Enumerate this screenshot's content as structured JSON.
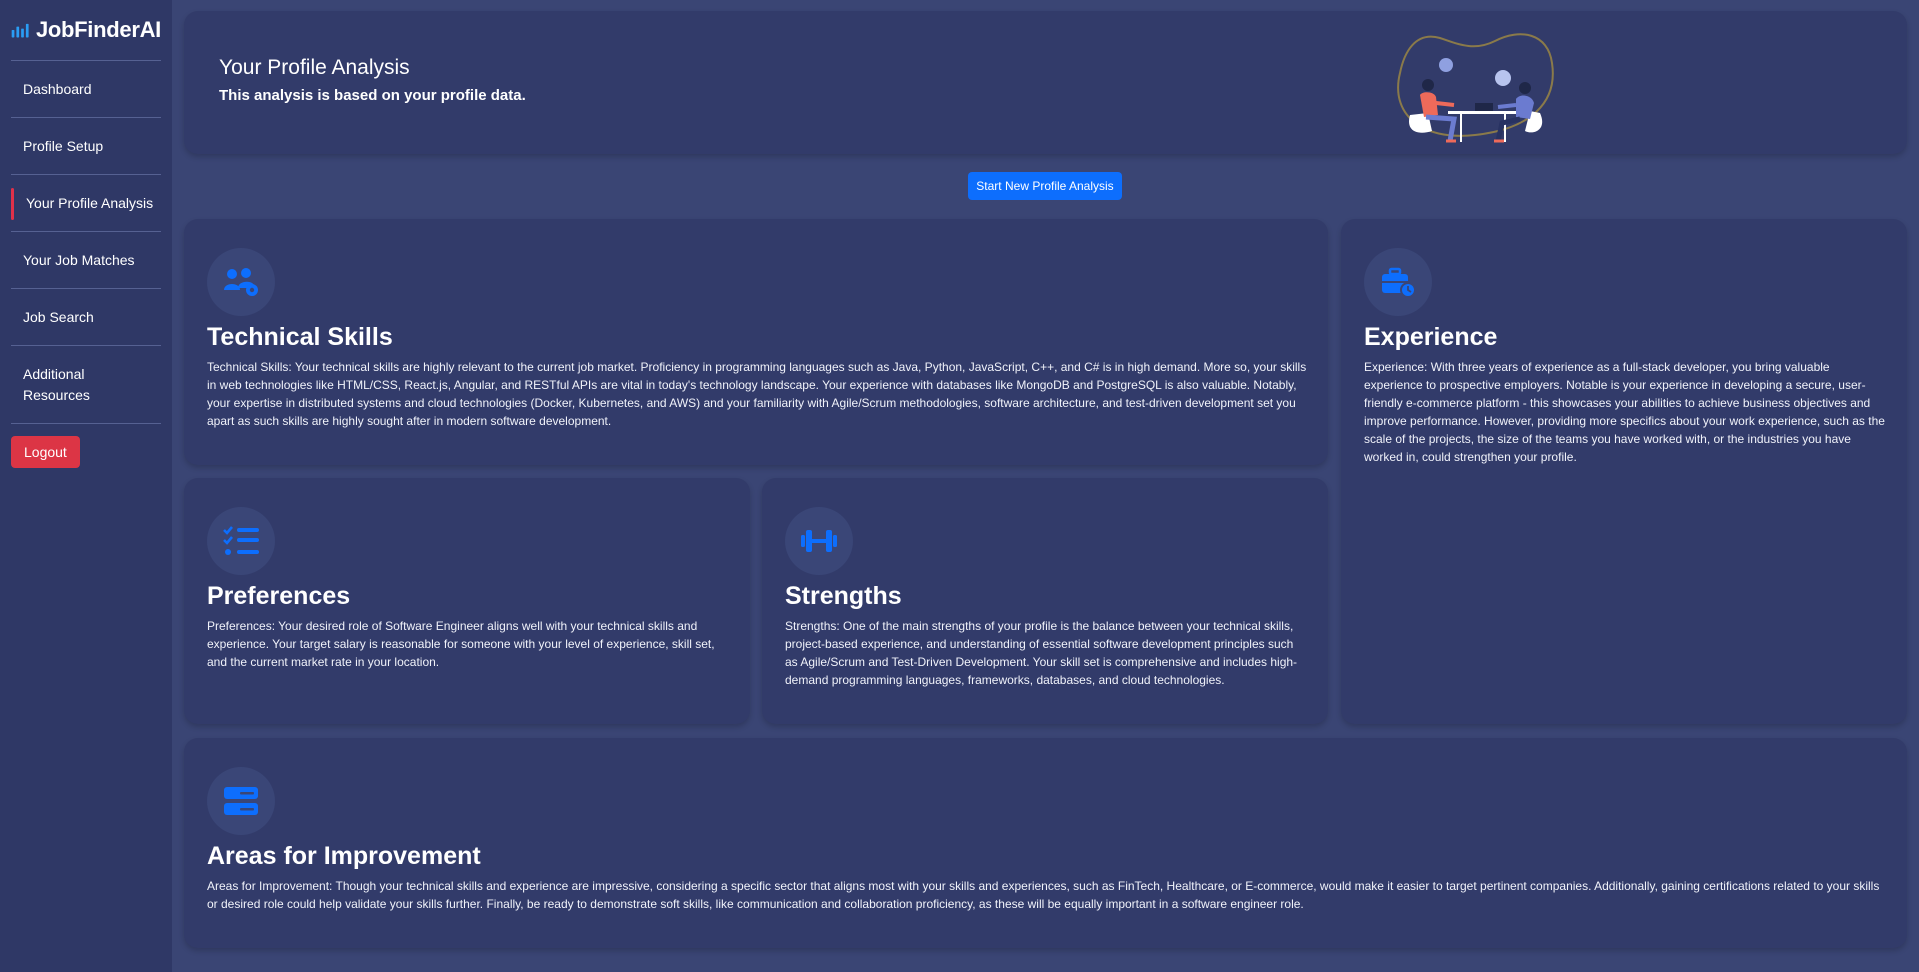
{
  "app": {
    "brand": "JobFinderAI",
    "accent_color": "#0d6efd",
    "danger_color": "#dc3545"
  },
  "sidebar": {
    "items": [
      {
        "label": "Dashboard",
        "active": false
      },
      {
        "label": "Profile Setup",
        "active": false
      },
      {
        "label": "Your Profile Analysis",
        "active": true
      },
      {
        "label": "Your Job Matches",
        "active": false
      },
      {
        "label": "Job Search",
        "active": false
      },
      {
        "label": "Additional Resources",
        "active": false
      }
    ],
    "logout_label": "Logout"
  },
  "header": {
    "title": "Your Profile Analysis",
    "subtitle": "This analysis is based on your profile data."
  },
  "actions": {
    "start_new_label": "Start New Profile Analysis"
  },
  "cards": {
    "technical": {
      "icon": "users-gear-icon",
      "title": "Technical Skills",
      "text": "Technical Skills: Your technical skills are highly relevant to the current job market. Proficiency in programming languages such as Java, Python, JavaScript, C++, and C# is in high demand. More so, your skills in web technologies like HTML/CSS, React.js, Angular, and RESTful APIs are vital in today's technology landscape. Your experience with databases like MongoDB and PostgreSQL is also valuable. Notably, your expertise in distributed systems and cloud technologies (Docker, Kubernetes, and AWS) and your familiarity with Agile/Scrum methodologies, software architecture, and test-driven development set you apart as such skills are highly sought after in modern software development."
    },
    "experience": {
      "icon": "briefcase-clock-icon",
      "title": "Experience",
      "text": "Experience: With three years of experience as a full-stack developer, you bring valuable experience to prospective employers. Notable is your experience in developing a secure, user-friendly e-commerce platform - this showcases your abilities to achieve business objectives and improve performance. However, providing more specifics about your work experience, such as the scale of the projects, the size of the teams you have worked with, or the industries you have worked in, could strengthen your profile."
    },
    "preferences": {
      "icon": "checklist-icon",
      "title": "Preferences",
      "text": "Preferences: Your desired role of Software Engineer aligns well with your technical skills and experience. Your target salary is reasonable for someone with your level of experience, skill set, and the current market rate in your location."
    },
    "strengths": {
      "icon": "dumbbell-icon",
      "title": "Strengths",
      "text": "Strengths: One of the main strengths of your profile is the balance between your technical skills, project-based experience, and understanding of essential software development principles such as Agile/Scrum and Test-Driven Development. Your skill set is comprehensive and includes high-demand programming languages, frameworks, databases, and cloud technologies."
    },
    "improvement": {
      "icon": "server-icon",
      "title": "Areas for Improvement",
      "text": "Areas for Improvement: Though your technical skills and experience are impressive, considering a specific sector that aligns most with your skills and experiences, such as FinTech, Healthcare, or E-commerce, would make it easier to target pertinent companies. Additionally, gaining certifications related to your skills or desired role could help validate your skills further. Finally, be ready to demonstrate soft skills, like communication and collaboration proficiency, as these will be equally important in a software engineer role."
    }
  }
}
